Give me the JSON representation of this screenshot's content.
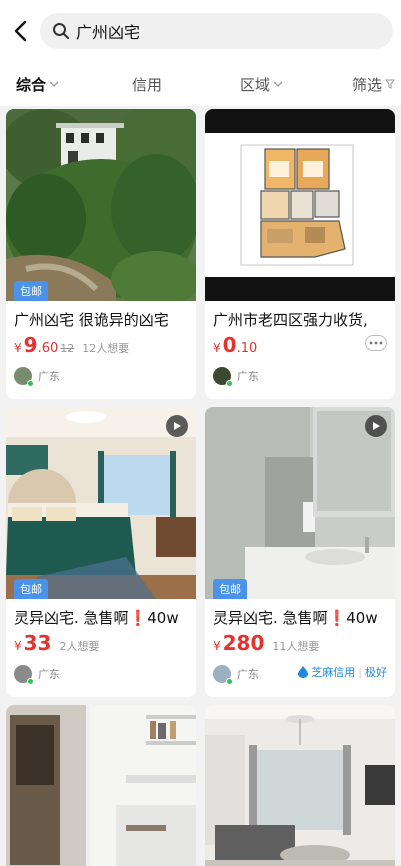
{
  "header": {
    "back_icon": "chevron-left-icon",
    "search_icon": "search-icon",
    "query": "广州凶宅"
  },
  "filters": [
    {
      "label": "综合",
      "active": true,
      "icon": "chevron-down-icon"
    },
    {
      "label": "信用",
      "active": false
    },
    {
      "label": "区域",
      "active": false,
      "icon": "chevron-down-icon"
    },
    {
      "label": "筛选",
      "active": false,
      "icon": "filter-icon"
    }
  ],
  "listings": [
    {
      "tag": "包邮",
      "title": "广州凶宅 很诡异的凶宅",
      "price_symbol": "¥",
      "price_int": "9",
      "price_dec": ".60",
      "original_price": "12",
      "wants": "12人想要",
      "location": "广东"
    },
    {
      "title": "广州市老四区强力收货,",
      "price_symbol": "¥",
      "price_int": "0",
      "price_dec": ".10",
      "more_icon": "more-icon",
      "location": "广东"
    },
    {
      "tag": "包邮",
      "title_prefix": "灵异凶宅. 急售啊",
      "title_mark": "❗",
      "title_suffix": "40w",
      "price_symbol": "¥",
      "price_int": "33",
      "wants": "2人想要",
      "location": "广东",
      "play_icon": "play-icon"
    },
    {
      "tag": "包邮",
      "title_prefix": "灵异凶宅. 急售啊",
      "title_mark": "❗",
      "title_suffix": "40w",
      "price_symbol": "¥",
      "price_int": "280",
      "wants": "11人想要",
      "location": "广东",
      "play_icon": "play-icon",
      "credit_label": "芝麻信用",
      "credit_level": "极好"
    }
  ],
  "colors": {
    "price": "#e5322d",
    "tag_bg": "#4a93e8",
    "credit": "#1f8ae0",
    "online_dot": "#2fc25b"
  }
}
